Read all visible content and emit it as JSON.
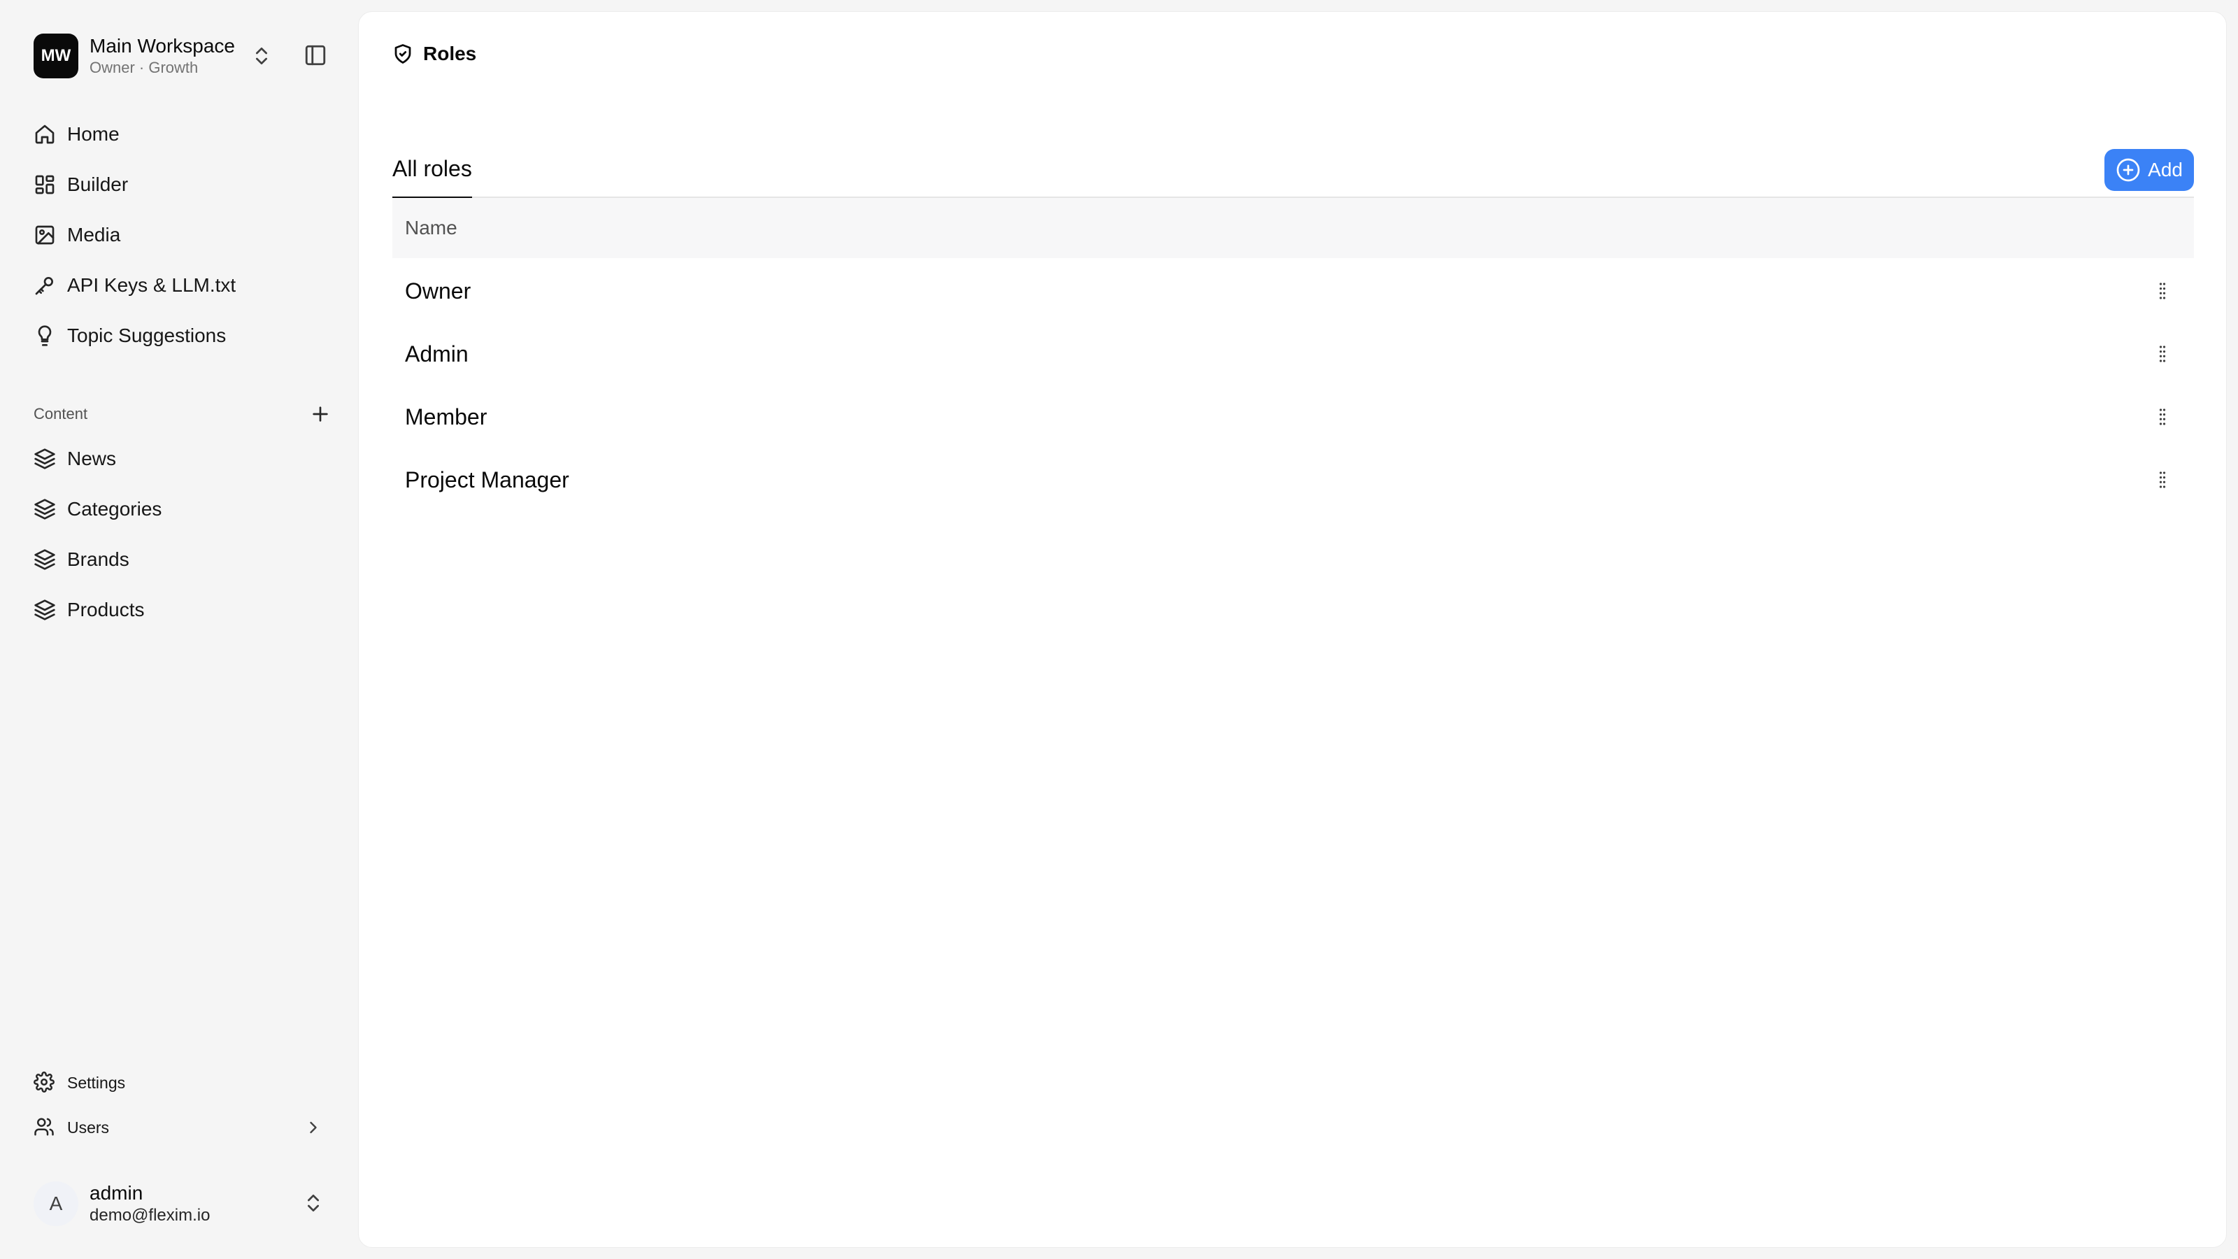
{
  "workspace": {
    "initials": "MW",
    "name": "Main Workspace",
    "subtitle": "Owner · Growth"
  },
  "nav": {
    "items": [
      {
        "label": "Home",
        "icon": "home-icon"
      },
      {
        "label": "Builder",
        "icon": "layout-grid-icon"
      },
      {
        "label": "Media",
        "icon": "image-icon"
      },
      {
        "label": "API Keys & LLM.txt",
        "icon": "key-icon"
      },
      {
        "label": "Topic Suggestions",
        "icon": "lightbulb-icon"
      }
    ]
  },
  "content": {
    "label": "Content",
    "items": [
      {
        "label": "News",
        "icon": "layers-icon"
      },
      {
        "label": "Categories",
        "icon": "layers-icon"
      },
      {
        "label": "Brands",
        "icon": "layers-icon"
      },
      {
        "label": "Products",
        "icon": "layers-icon"
      }
    ]
  },
  "bottom_nav": {
    "settings_label": "Settings",
    "users_label": "Users"
  },
  "user": {
    "initial": "A",
    "name": "admin",
    "email": "demo@flexim.io"
  },
  "page": {
    "title": "Roles",
    "tab_label": "All roles",
    "add_label": "Add"
  },
  "table": {
    "column_name": "Name",
    "rows": [
      "Owner",
      "Admin",
      "Member",
      "Project Manager"
    ]
  },
  "colors": {
    "accent": "#3b82f6",
    "sidebar_bg": "#f5f5f5",
    "main_bg": "#ffffff"
  }
}
